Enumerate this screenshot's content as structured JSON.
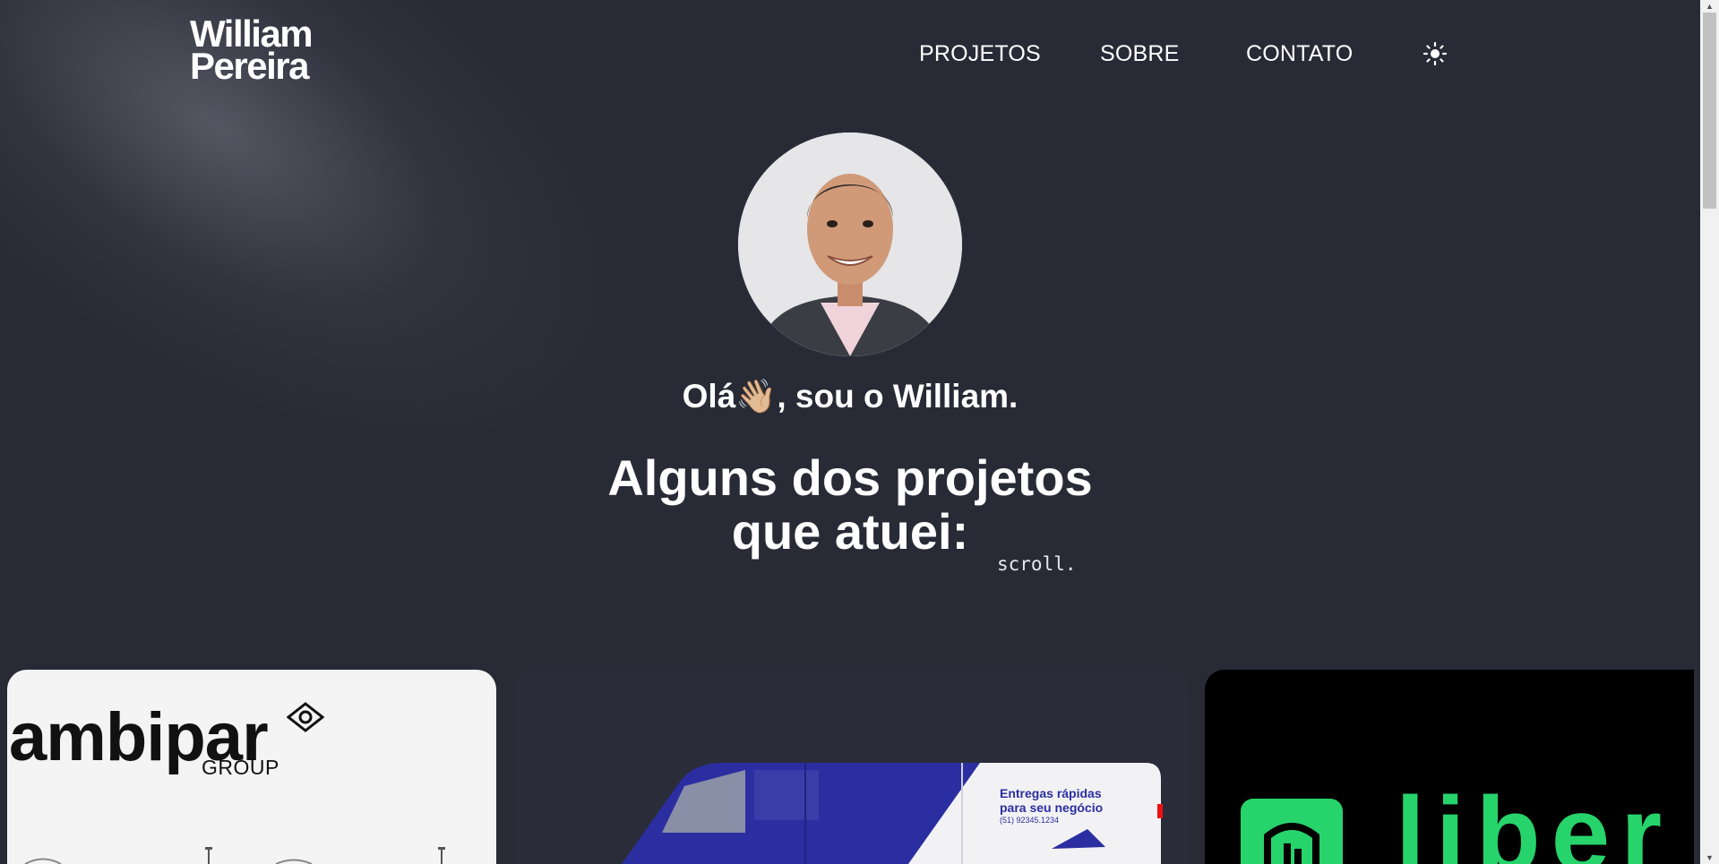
{
  "header": {
    "logo_line1": "William",
    "logo_line2": "Pereira",
    "nav": [
      {
        "label": "PROJETOS"
      },
      {
        "label": "SOBRE"
      },
      {
        "label": "CONTATO"
      }
    ],
    "theme_toggle_icon": "sun-icon"
  },
  "hero": {
    "greeting_before": "Olá",
    "greeting_emoji": "👋🏼",
    "greeting_after": ", sou o William.",
    "headline_line1": "Alguns dos projetos",
    "headline_line2": "que atuei:",
    "scroll_hint": "scroll."
  },
  "projects": [
    {
      "brand": "ambipar",
      "sub": "GROUP"
    },
    {
      "tagline_normal": "Entregas ",
      "tagline_bold": "rápidas",
      "tagline_line2": "para seu negócio",
      "phone": "(51) 92345.1234"
    },
    {
      "brand": "liber"
    }
  ],
  "colors": {
    "background": "#282a36",
    "text": "#ffffff",
    "liber_green": "#27d36b",
    "van_blue": "#2b2ea0"
  }
}
